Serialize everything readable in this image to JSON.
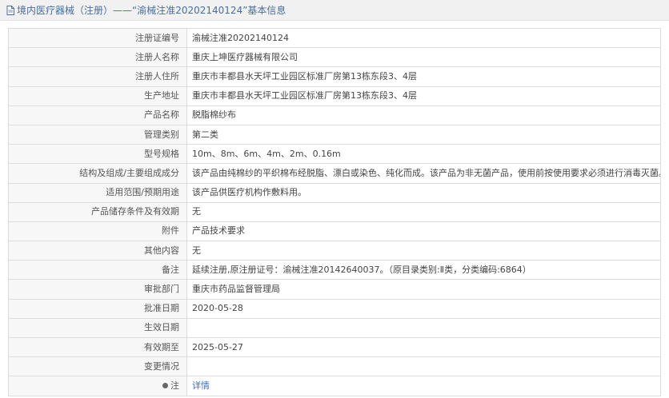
{
  "header": {
    "icon": "document-icon",
    "title": "境内医疗器械（注册）——“渝械注准20202140124”基本信息"
  },
  "rows": [
    {
      "label": "注册证编号",
      "value": "渝械注准20202140124"
    },
    {
      "label": "注册人名称",
      "value": "重庆上坤医疗器械有限公司"
    },
    {
      "label": "注册人住所",
      "value": "重庆市丰都县水天坪工业园区标准厂房第13栋东段3、4层"
    },
    {
      "label": "生产地址",
      "value": "重庆市丰都县水天坪工业园区标准厂房第13栋东段3、4层"
    },
    {
      "label": "产品名称",
      "value": "脱脂棉纱布"
    },
    {
      "label": "管理类别",
      "value": "第二类"
    },
    {
      "label": "型号规格",
      "value": "10m、8m、6m、4m、2m、0.16m"
    },
    {
      "label": "结构及组成/主要组成成分",
      "value": "该产品由纯棉纱的平织棉布经脱脂、漂白或染色、纯化而成。该产品为非无菌产品，使用前按使用要求必须进行消毒灭菌。"
    },
    {
      "label": "适用范围/预期用途",
      "value": "该产品供医疗机构作敷料用。"
    },
    {
      "label": "产品储存条件及有效期",
      "value": "无"
    },
    {
      "label": "附件",
      "value": "产品技术要求"
    },
    {
      "label": "其他内容",
      "value": "无"
    },
    {
      "label": "备注",
      "value": "延续注册,原注册证号：渝械注准20142640037。（原目录类别:Ⅱ类，分类编码:6864）"
    },
    {
      "label": "审批部门",
      "value": "重庆市药品监督管理局"
    },
    {
      "label": "批准日期",
      "value": "2020-05-28"
    },
    {
      "label": "生效日期",
      "value": ""
    },
    {
      "label": "有效期至",
      "value": "2025-05-27"
    },
    {
      "label": "变更情况",
      "value": ""
    }
  ],
  "note": {
    "icon": "dot-icon",
    "label": "注",
    "link_text": "详情"
  },
  "colors": {
    "header_text": "#4a6e9b",
    "label_bg": "#f7f7f7",
    "link": "#3a72c4"
  }
}
